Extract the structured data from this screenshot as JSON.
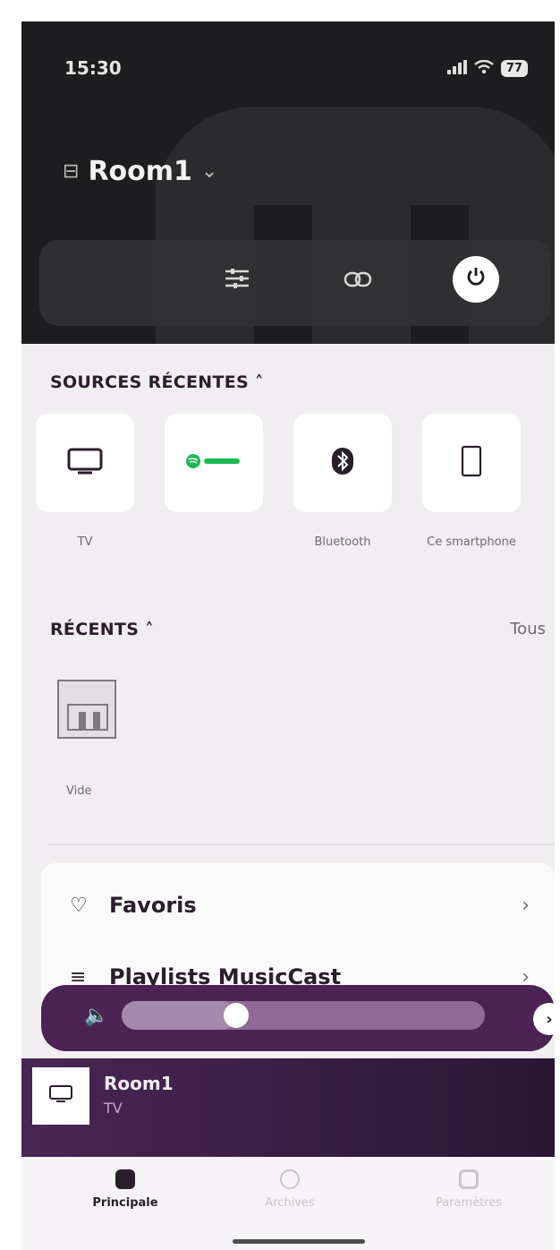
{
  "status": {
    "time": "15:30",
    "battery": "77"
  },
  "room": {
    "name": "Room1"
  },
  "sections": {
    "sources_title": "SOURCES RÉCENTES",
    "recents_title": "RÉCENTS",
    "see_all": "Tous"
  },
  "sources": [
    {
      "label": "TV",
      "icon": "tv-icon"
    },
    {
      "label": "",
      "icon": "spotify-icon"
    },
    {
      "label": "Bluetooth",
      "icon": "bluetooth-icon"
    },
    {
      "label": "Ce smartphone",
      "icon": "smartphone-icon"
    }
  ],
  "recents": [
    {
      "label": "Vide"
    }
  ],
  "menu": [
    {
      "label": "Favoris",
      "icon": "heart-icon"
    },
    {
      "label": "Playlists MusicCast",
      "icon": "playlist-icon"
    }
  ],
  "volume": {
    "level_fraction": 0.28
  },
  "now_playing": {
    "room": "Room1",
    "source": "TV"
  },
  "tabs": [
    {
      "label": "Principale",
      "active": true
    },
    {
      "label": "Archives",
      "active": false
    },
    {
      "label": "Paramètres",
      "active": false
    }
  ],
  "colors": {
    "header_bg": "#1d1c1e",
    "content_bg": "#f1eef1",
    "accent_purple": "#4b2453",
    "spotify_green": "#1db954"
  }
}
